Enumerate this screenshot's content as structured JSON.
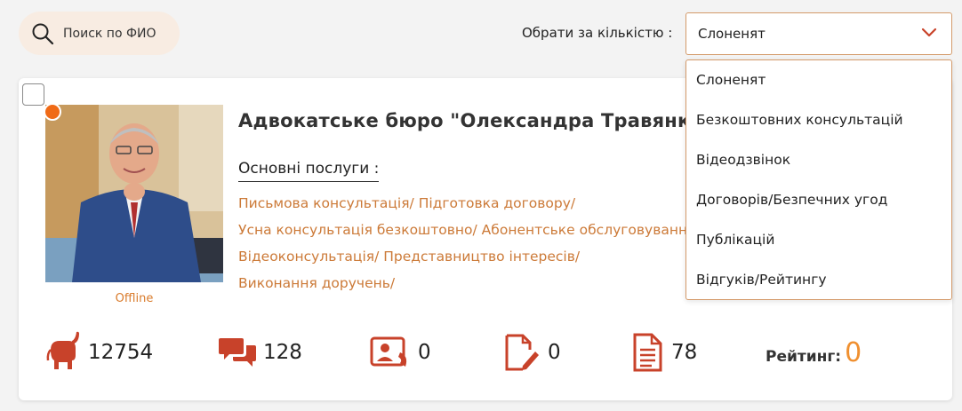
{
  "search": {
    "placeholder": "Поиск по ФИО"
  },
  "sort": {
    "label": "Обрати за кількістю :",
    "selected": "Слоненят",
    "options": [
      "Слоненят",
      "Безкоштовних консультацій",
      "Відеодзвінок",
      "Договорів/Безпечних угод",
      "Публікацій",
      "Відгуків/Рейтингу"
    ]
  },
  "card": {
    "title": "Адвокатське бюро \"Олександра Травянко\"",
    "status": "Offline",
    "services_label": "Основні послуги :",
    "services": [
      [
        "Письмова консультація/",
        "Підготовка договору/"
      ],
      [
        "Усна консультація безкоштовно/",
        "Абонентське обслуговування/"
      ],
      [
        "Відеоконсультація/",
        "Представництво інтересів/"
      ],
      [
        "Виконання доручень/"
      ]
    ],
    "stats": {
      "elephants": "12754",
      "consultations": "128",
      "video_calls": "0",
      "contracts": "0",
      "publications": "78",
      "rating_label": "Рейтинг:",
      "rating_value": "0"
    }
  },
  "colors": {
    "accent": "#cc7a38",
    "icon_red": "#c8422a",
    "rating": "#f09030",
    "status_dot": "#f06a16"
  }
}
